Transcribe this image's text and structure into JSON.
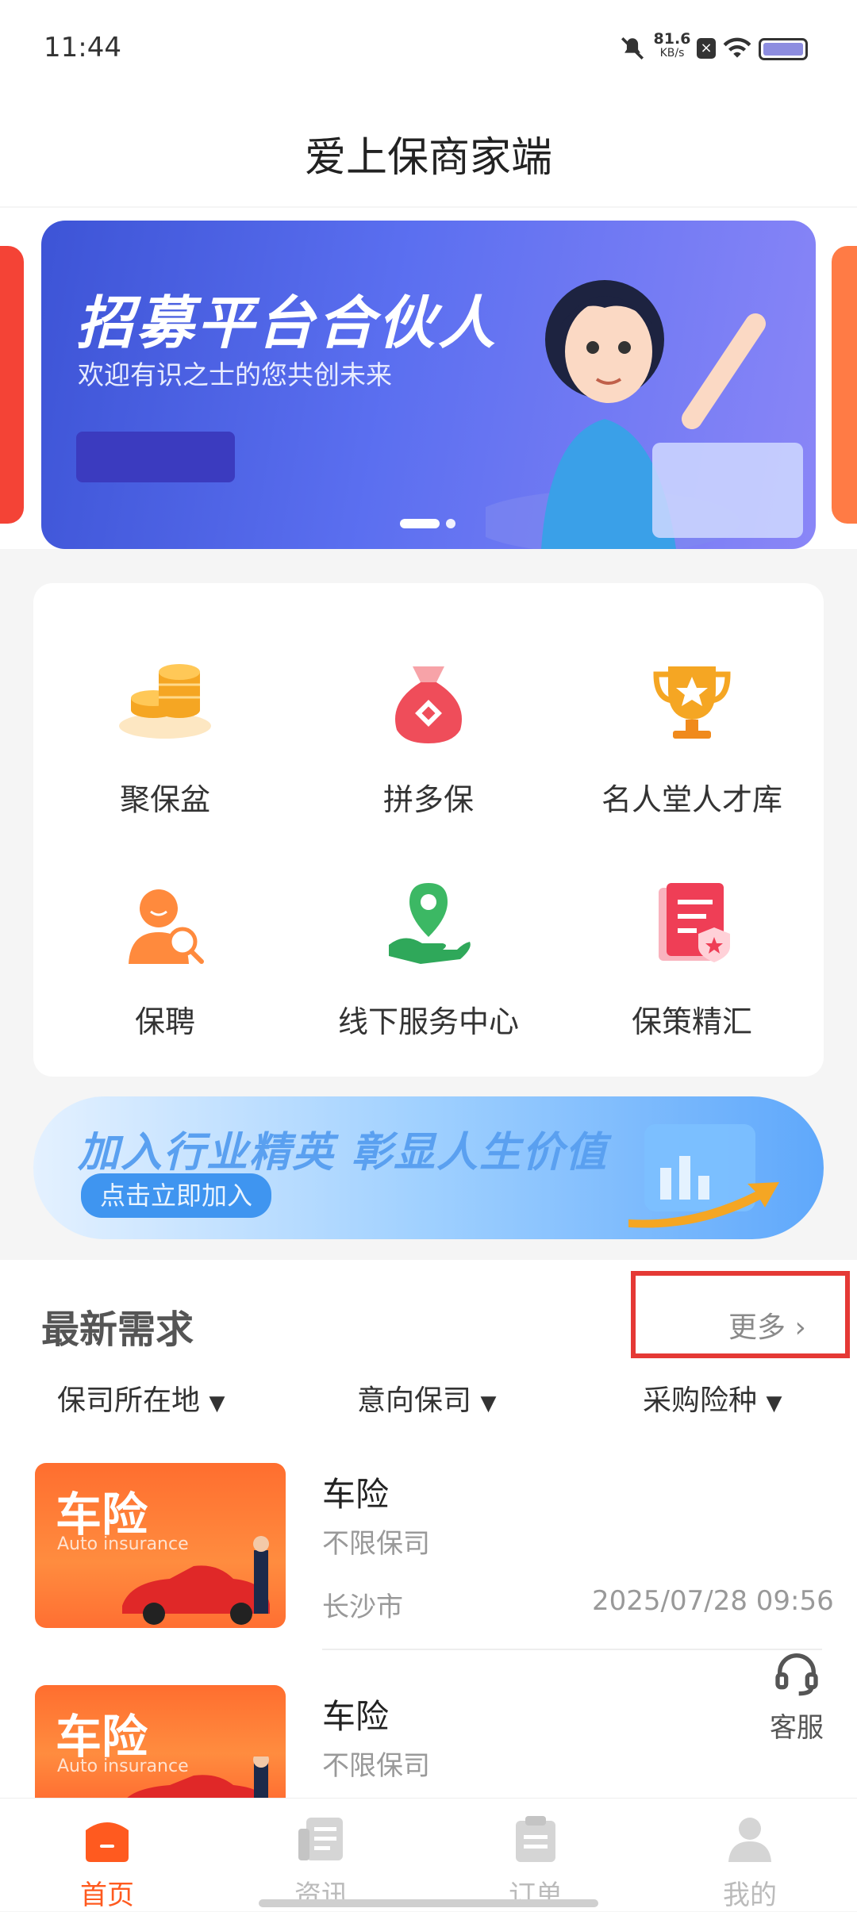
{
  "status_bar": {
    "time": "11:44",
    "net_speed": "81.6",
    "net_unit": "KB/s"
  },
  "header": {
    "title": "爱上保商家端"
  },
  "banner": {
    "title": "招募平台合伙人",
    "subtitle": "欢迎有识之士的您共创未来"
  },
  "grid": [
    {
      "label": "聚保盆",
      "icon": "coins-icon"
    },
    {
      "label": "拼多保",
      "icon": "money-bag-icon"
    },
    {
      "label": "名人堂人才库",
      "icon": "trophy-icon"
    },
    {
      "label": "保聘",
      "icon": "person-search-icon"
    },
    {
      "label": "线下服务中心",
      "icon": "location-hand-icon"
    },
    {
      "label": "保策精汇",
      "icon": "policy-doc-icon"
    }
  ],
  "promo": {
    "title": "加入行业精英  彰显人生价值",
    "button": "点击立即加入"
  },
  "latest": {
    "title": "最新需求",
    "more": "更多",
    "filters": [
      "保司所在地",
      "意向保司",
      "采购险种"
    ],
    "items": [
      {
        "thumb_title": "车险",
        "thumb_sub": "Auto insurance",
        "title": "车险",
        "company": "不限保司",
        "location": "长沙市",
        "date": "2025/07/28 09:56"
      },
      {
        "thumb_title": "车险",
        "thumb_sub": "Auto insurance",
        "title": "车险",
        "company": "不限保司"
      }
    ]
  },
  "service": {
    "label": "客服"
  },
  "tabbar": [
    {
      "label": "首页",
      "active": true
    },
    {
      "label": "资讯",
      "active": false
    },
    {
      "label": "订单",
      "active": false
    },
    {
      "label": "我的",
      "active": false
    }
  ],
  "colors": {
    "accent": "#ff5a1f",
    "highlight_box": "#e53935",
    "banner": "#5b6ff0"
  }
}
